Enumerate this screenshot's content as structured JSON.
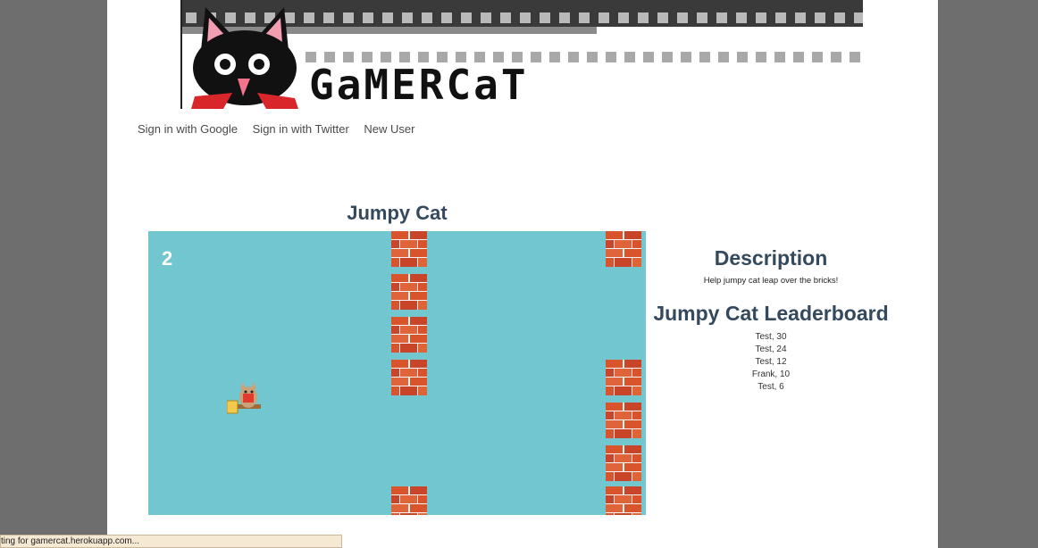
{
  "banner": {
    "logo_text": "GaMERCaT",
    "mascot_icon": "black-cat-mascot-icon"
  },
  "nav": {
    "items": [
      {
        "label": "Sign in with Google"
      },
      {
        "label": "Sign in with Twitter"
      },
      {
        "label": "New User"
      }
    ]
  },
  "game": {
    "title": "Jumpy Cat",
    "score": "2",
    "player_icon": "flying-cat-icon",
    "obstacle_icon": "brick-icon",
    "background_color": "#72c6cf"
  },
  "sidebar": {
    "description_heading": "Description",
    "description_text": "Help jumpy cat leap over the bricks!",
    "leaderboard_heading": "Jumpy Cat Leaderboard",
    "leaderboard": [
      "Test, 30",
      "Test, 24",
      "Test, 12",
      "Frank, 10",
      "Test, 6"
    ]
  },
  "status_bar": {
    "text": "ting for gamercat.herokuapp.com..."
  },
  "colors": {
    "heading": "#34495e",
    "page_background": "#6e6e6e",
    "brick": "#d9542b"
  }
}
